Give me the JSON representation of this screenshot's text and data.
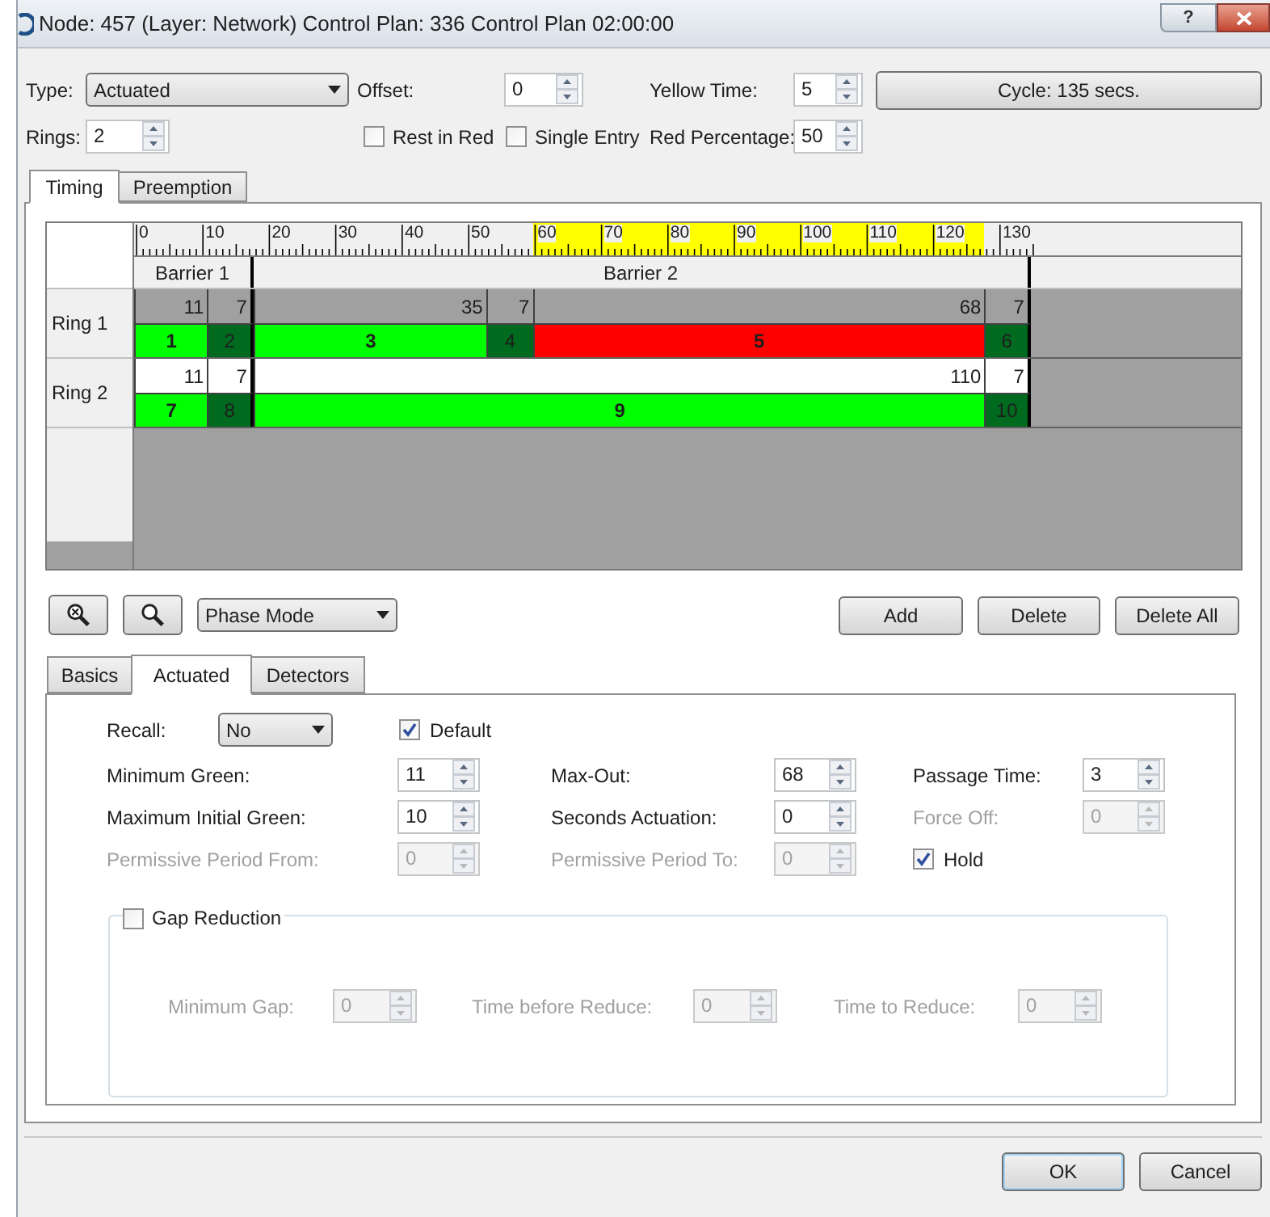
{
  "window": {
    "title": "Node: 457 (Layer: Network) Control Plan: 336 Control Plan 02:00:00",
    "help_button": "?"
  },
  "type": {
    "label": "Type:",
    "value": "Actuated"
  },
  "offset": {
    "label": "Offset:",
    "value": "0"
  },
  "yellow_time": {
    "label": "Yellow Time:",
    "value": "5"
  },
  "cycle_button": "Cycle: 135 secs.",
  "rings_field": {
    "label": "Rings:",
    "value": "2"
  },
  "options": [
    {
      "label": "Rest in Red",
      "checked": false
    },
    {
      "label": "Single Entry",
      "checked": false
    }
  ],
  "red_percentage": {
    "label": "Red Percentage:",
    "value": "50"
  },
  "tabs": [
    {
      "label": "Timing",
      "selected": true
    },
    {
      "label": "Preemption",
      "selected": false
    }
  ],
  "timeline": {
    "ruler": [
      "0",
      "10",
      "20",
      "30",
      "40",
      "50",
      "60",
      "70",
      "80",
      "90",
      "100",
      "110",
      "120",
      "130"
    ],
    "barriers": [
      {
        "label": "Barrier 1"
      },
      {
        "label": "Barrier 2"
      }
    ],
    "rings": [
      {
        "label": "Ring 1",
        "selected": true,
        "phases": [
          {
            "number": "1",
            "duration": "11",
            "kind": "green",
            "selected": false,
            "barrier_end": false
          },
          {
            "number": "2",
            "duration": "7",
            "kind": "change",
            "selected": false,
            "barrier_end": true
          },
          {
            "number": "3",
            "duration": "35",
            "kind": "green",
            "selected": false,
            "barrier_end": false
          },
          {
            "number": "4",
            "duration": "7",
            "kind": "change",
            "selected": false,
            "barrier_end": false
          },
          {
            "number": "5",
            "duration": "68",
            "kind": "green",
            "selected": true,
            "barrier_end": false
          },
          {
            "number": "6",
            "duration": "7",
            "kind": "change",
            "selected": false,
            "barrier_end": true
          }
        ]
      },
      {
        "label": "Ring 2",
        "selected": false,
        "phases": [
          {
            "number": "7",
            "duration": "11",
            "kind": "green",
            "selected": false,
            "barrier_end": false
          },
          {
            "number": "8",
            "duration": "7",
            "kind": "change",
            "selected": false,
            "barrier_end": true
          },
          {
            "number": "9",
            "duration": "110",
            "kind": "green",
            "selected": false,
            "barrier_end": false
          },
          {
            "number": "10",
            "duration": "7",
            "kind": "change",
            "selected": false,
            "barrier_end": true
          }
        ]
      }
    ]
  },
  "toolbar": {
    "mode": "Phase Mode",
    "buttons": [
      "Add",
      "Delete",
      "Delete All"
    ]
  },
  "phase_tabs": [
    {
      "label": "Basics",
      "selected": false
    },
    {
      "label": "Actuated",
      "selected": true
    },
    {
      "label": "Detectors",
      "selected": false
    }
  ],
  "recall": {
    "label": "Recall:",
    "value": "No"
  },
  "default_option": {
    "label": "Default",
    "checked": true
  },
  "fields": [
    [
      {
        "kind": "spin",
        "label": "Minimum Green:",
        "value": "11",
        "disabled": false
      },
      {
        "kind": "spin",
        "label": "Max-Out:",
        "value": "68",
        "disabled": false
      },
      {
        "kind": "spin",
        "label": "Passage Time:",
        "value": "3",
        "disabled": false
      }
    ],
    [
      {
        "kind": "spin",
        "label": "Maximum Initial Green:",
        "value": "10",
        "disabled": false
      },
      {
        "kind": "spin",
        "label": "Seconds Actuation:",
        "value": "0",
        "disabled": false
      },
      {
        "kind": "spin",
        "label": "Force Off:",
        "value": "0",
        "disabled": true
      }
    ],
    [
      {
        "kind": "spin",
        "label": "Permissive Period From:",
        "value": "0",
        "disabled": true
      },
      {
        "kind": "spin",
        "label": "Permissive Period To:",
        "value": "0",
        "disabled": true
      },
      {
        "kind": "checkbox",
        "label": "Hold",
        "checked": true
      }
    ]
  ],
  "gap_reduction": {
    "label": "Gap Reduction",
    "checked": false,
    "fields": [
      {
        "label": "Minimum Gap:",
        "value": "0",
        "disabled": true
      },
      {
        "label": "Time before Reduce:",
        "value": "0",
        "disabled": true
      },
      {
        "label": "Time to Reduce:",
        "value": "0",
        "disabled": true
      }
    ]
  },
  "dialog_buttons": [
    {
      "label": "OK",
      "default": true
    },
    {
      "label": "Cancel",
      "default": false
    }
  ]
}
